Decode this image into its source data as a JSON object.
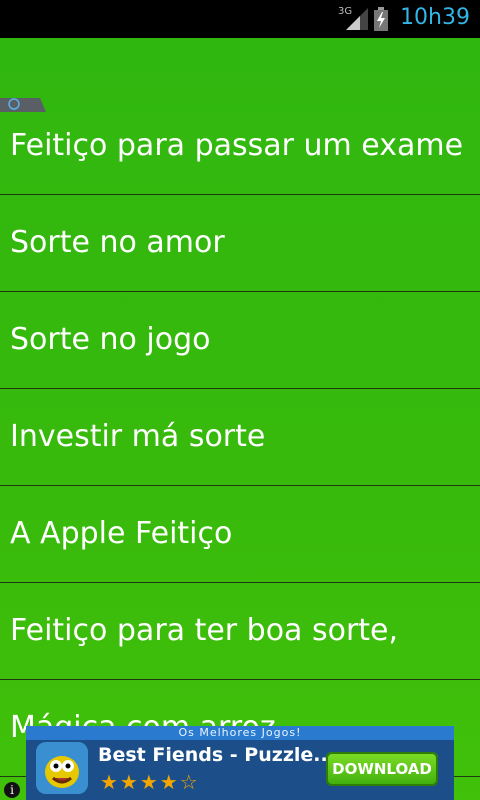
{
  "status_bar": {
    "network": "3G",
    "time": "10h39"
  },
  "list": {
    "items": [
      {
        "label": "Feitiço para passar um exame"
      },
      {
        "label": "Sorte no amor"
      },
      {
        "label": "Sorte no jogo"
      },
      {
        "label": "Investir má sorte"
      },
      {
        "label": "A Apple Feitiço"
      },
      {
        "label": "Feitiço para ter boa sorte,"
      },
      {
        "label": "Mágica com arroz"
      }
    ]
  },
  "ad": {
    "ribbon_text": "Os Melhores Jogos!",
    "title": "Best Fiends - Puzzle...",
    "rating": 4.5,
    "stars_text": "★★★★☆",
    "download_label": "DOWNLOAD",
    "info_icon": "i"
  },
  "colors": {
    "background": "#3cb80c",
    "divider": "#1f3a10",
    "status_text": "#33b5e5"
  }
}
